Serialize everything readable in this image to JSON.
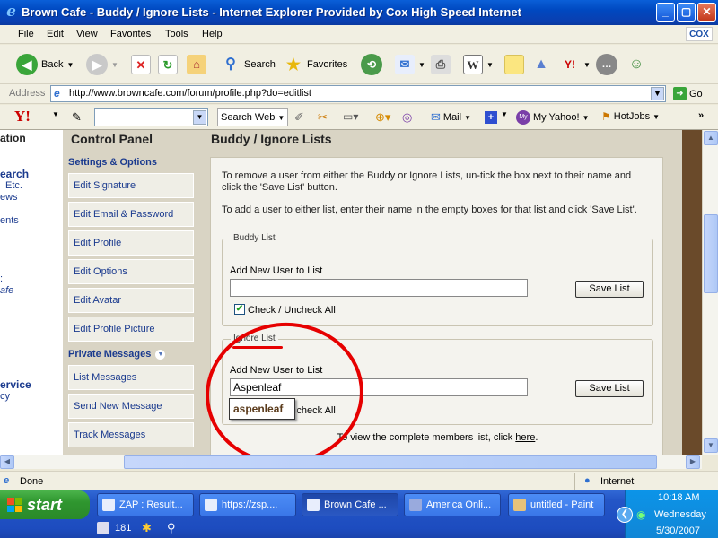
{
  "window": {
    "title": "Brown Cafe - Buddy / Ignore Lists - Internet Explorer Provided by Cox High Speed Internet",
    "controls": {
      "minimize": "_",
      "maximize": "▢",
      "close": "✕"
    }
  },
  "menu": {
    "items": [
      "File",
      "Edit",
      "View",
      "Favorites",
      "Tools",
      "Help"
    ],
    "brand": "COX"
  },
  "toolbar": {
    "back": "Back",
    "search": "Search",
    "favorites": "Favorites"
  },
  "address": {
    "label": "Address",
    "url": "http://www.browncafe.com/forum/profile.php?do=editlist",
    "go": "Go"
  },
  "yahoo_bar": {
    "logo": "Y!",
    "search_web": "Search Web",
    "mail": "Mail",
    "my_yahoo": "My Yahoo!",
    "hotjobs": "HotJobs"
  },
  "left_partial": {
    "lines": [
      "ation",
      "earch",
      "Etc.",
      "ews",
      "ents",
      ":",
      "afe",
      "ervice",
      "cy"
    ]
  },
  "control_panel": {
    "title": "Control Panel",
    "sections": [
      {
        "heading": "Settings & Options",
        "items": [
          "Edit Signature",
          "Edit Email & Password",
          "Edit Profile",
          "Edit Options",
          "Edit Avatar",
          "Edit Profile Picture"
        ]
      },
      {
        "heading": "Private Messages",
        "items": [
          "List Messages",
          "Send New Message",
          "Track Messages"
        ]
      }
    ]
  },
  "main": {
    "title": "Buddy / Ignore Lists",
    "instructions": [
      "To remove a user from either the Buddy or Ignore Lists, un-tick the box next to their name and click the 'Save List' button.",
      "To add a user to either list, enter their name in the empty boxes for that list and click 'Save List'."
    ],
    "buddy": {
      "legend": "Buddy List",
      "add_label": "Add New User to List",
      "input_value": "",
      "save": "Save List",
      "check_all": "Check / Uncheck All",
      "checked": true
    },
    "ignore": {
      "legend": "Ignore List",
      "add_label": "Add New User to List",
      "input_value": "Aspenleaf",
      "save": "Save List",
      "check_all": "Check / Uncheck All",
      "autocomplete": "aspenleaf"
    },
    "footer_text": "To view the complete members list, click",
    "footer_link": "here",
    "footer_end": "."
  },
  "status": {
    "text": "Done",
    "zone": "Internet"
  },
  "taskbar": {
    "start": "start",
    "tasks": [
      "ZAP : Result...",
      "https://zsp....",
      "Brown Cafe ...",
      "America Onli...",
      "untitled - Paint"
    ],
    "active_index": 2,
    "quick_count": "181",
    "clock": {
      "time": "10:18 AM",
      "day": "Wednesday",
      "date": "5/30/2007"
    }
  },
  "colors": {
    "title_blue": "#0048c0",
    "link_blue": "#1a3a8e",
    "annotation_red": "#e60000",
    "start_green": "#2f962f"
  }
}
